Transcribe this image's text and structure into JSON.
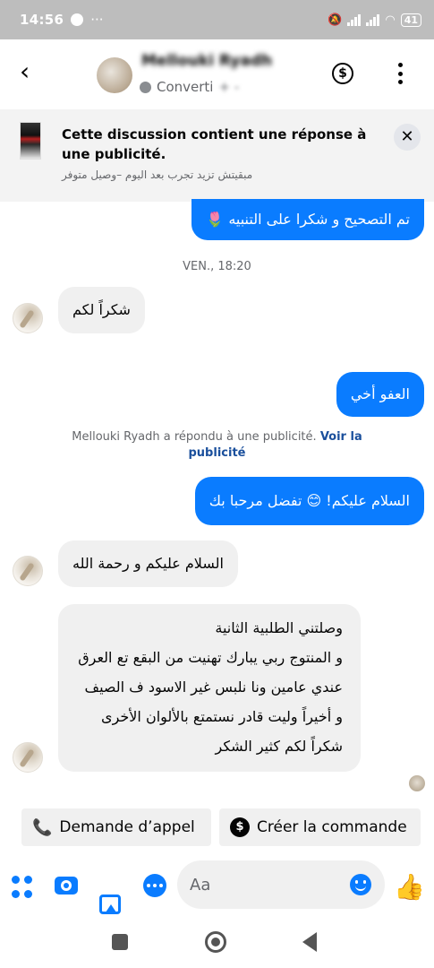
{
  "status_bar": {
    "time": "14:56",
    "dots": "···",
    "battery": "41"
  },
  "header": {
    "contact_name": "Mellouki Ryadh",
    "status": "Converti",
    "status_suffix": "+ -"
  },
  "ad_banner": {
    "title": "Cette discussion contient une réponse à une publicité.",
    "subtitle": "مبقيتش تزيد تجرب بعد اليوم –وصيل متوفر",
    "close": "✕"
  },
  "messages": [
    {
      "from": "me",
      "text": "تم التصحيح و شكرا على التنبيه 🌷"
    },
    {
      "timestamp": "VEN., 18:20"
    },
    {
      "from": "contact",
      "text": "شكراً لكم"
    },
    {
      "from": "me",
      "text": "العفو أخي"
    },
    {
      "notice": "Mellouki Ryadh a répondu à une publicité.",
      "link": "Voir la publicité"
    },
    {
      "from": "me",
      "text": "السلام عليكم! 😊 تفضل مرحبا بك"
    },
    {
      "from": "contact",
      "text": "السلام عليكم و رحمة الله"
    },
    {
      "from": "contact",
      "lines": [
        "وصلتني الطلبية الثانية",
        "و المنتوج ربي يبارك تهنيت من البقع تع العرق",
        "عندي عامين ونا نلبس غير الاسود ف الصيف",
        "و أخيراً وليت قادر نستمتع بالألوان الأخرى",
        "شكراً لكم كثير الشكر"
      ]
    }
  ],
  "quick_actions": {
    "call": "Demande d’appel",
    "order": "Créer la commande"
  },
  "composer": {
    "placeholder": "Aa"
  },
  "colors": {
    "accent": "#0a7cff",
    "incoming_bubble": "#f0f0f0",
    "banner_bg": "#f3f3f3",
    "status_bar": "#bdbdbd"
  },
  "icons": [
    "back-arrow-icon",
    "dollar-icon",
    "more-options-icon",
    "close-icon",
    "phone-plus-icon",
    "apps-icon",
    "camera-icon",
    "gallery-icon",
    "chat-bubble-icon",
    "emoji-icon",
    "like-icon"
  ]
}
